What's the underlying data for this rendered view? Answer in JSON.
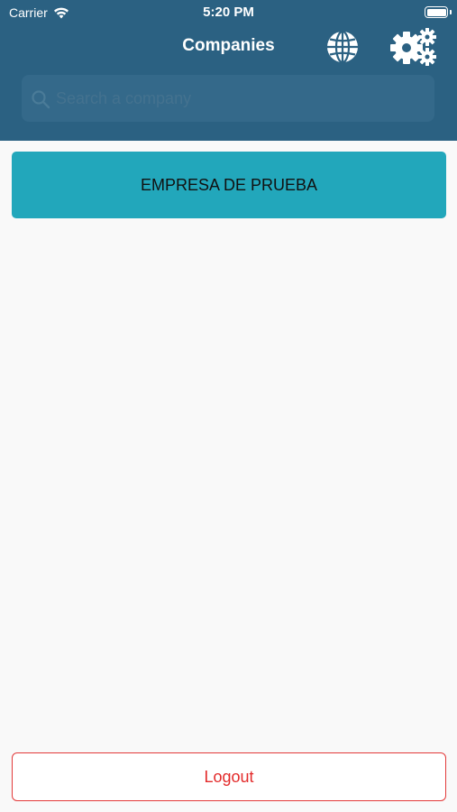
{
  "status_bar": {
    "carrier": "Carrier",
    "time": "5:20 PM",
    "icons": [
      "wifi-icon",
      "battery-icon"
    ]
  },
  "nav": {
    "title": "Companies",
    "icons": [
      "globe-icon",
      "gears-icon"
    ]
  },
  "search": {
    "placeholder": "Search a company",
    "value": "",
    "icon": "search-icon"
  },
  "companies": [
    {
      "name": "EMPRESA DE PRUEBA"
    }
  ],
  "logout": {
    "label": "Logout"
  },
  "colors": {
    "header": "#2b6182",
    "search_bg": "#34698a",
    "company_item": "#22a7bb",
    "logout": "#e32b2b",
    "background": "#f9f9f9"
  }
}
